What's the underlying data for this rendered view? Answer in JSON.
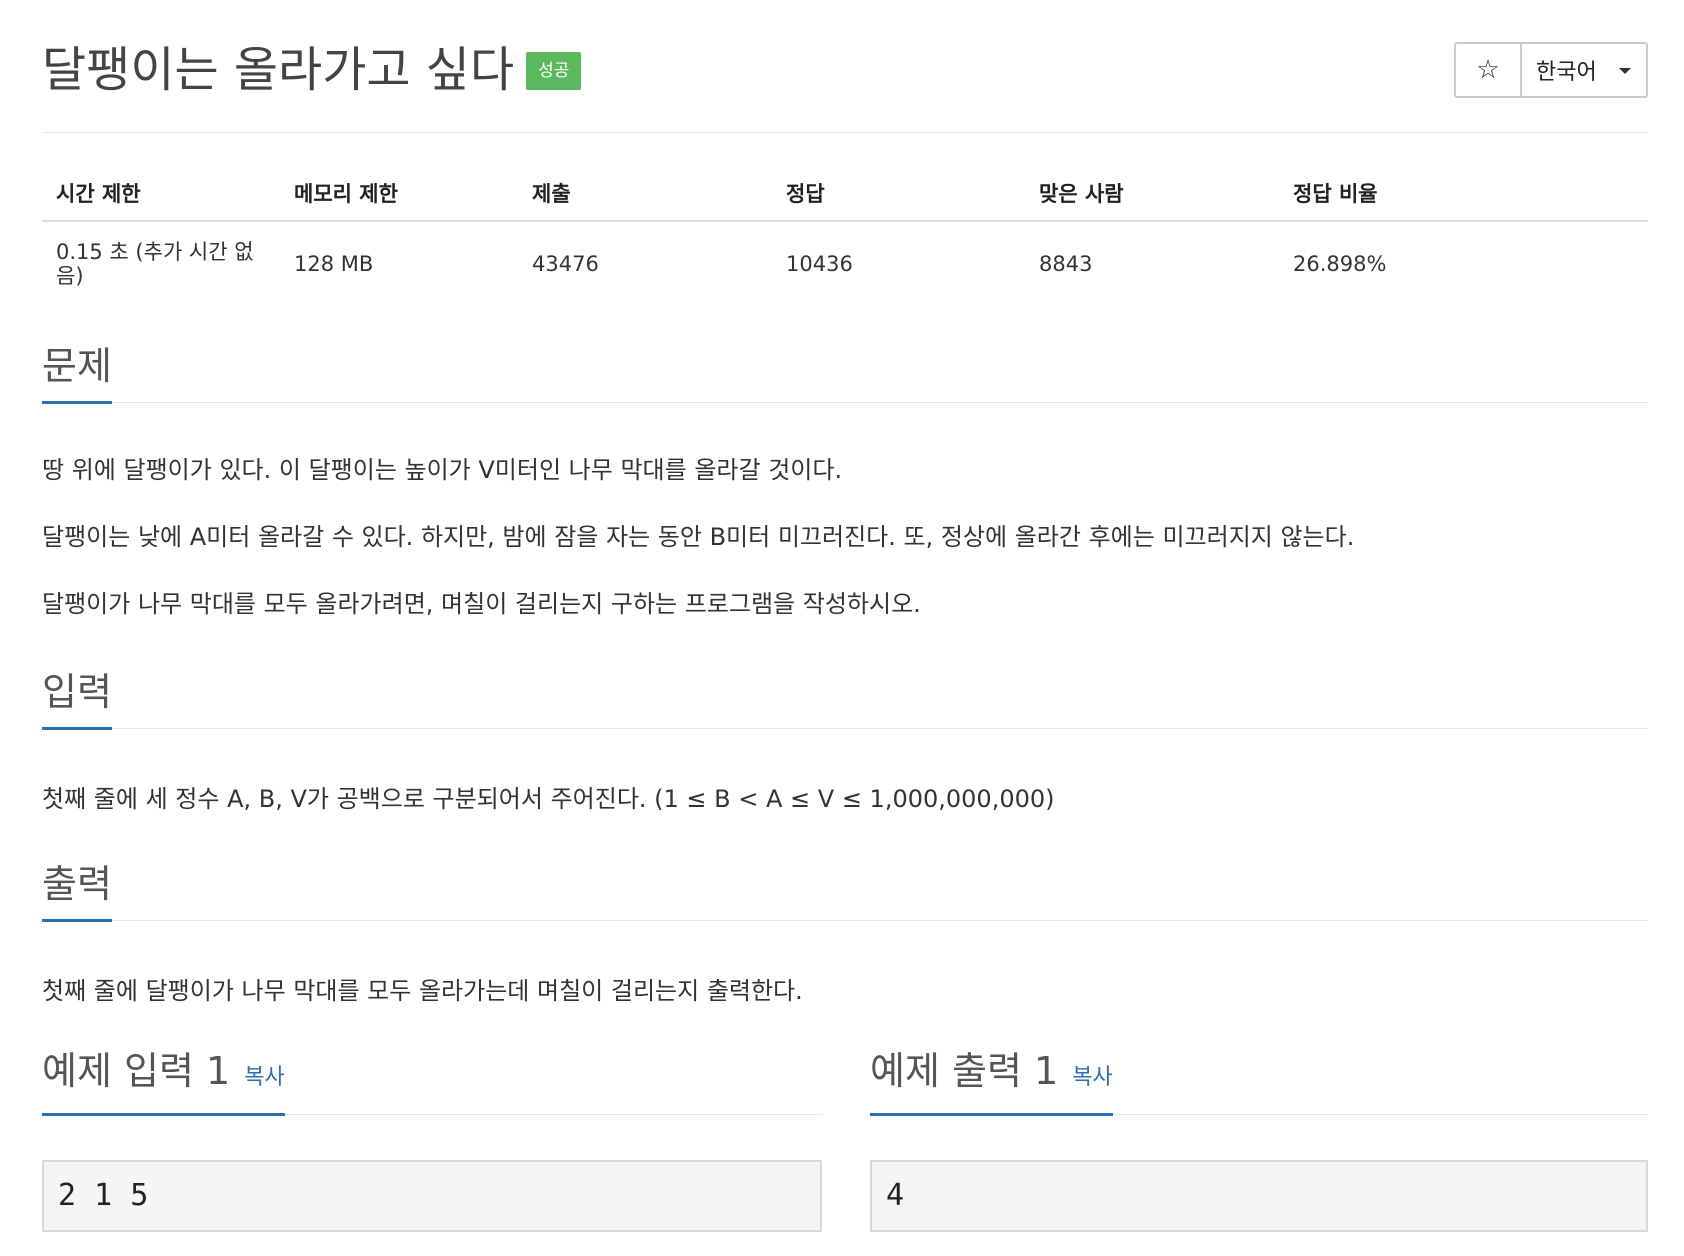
{
  "problem": {
    "title": "달팽이는 올라가고 싶다",
    "badge": "성공",
    "star_icon": "☆",
    "language": "한국어"
  },
  "info": {
    "headers": [
      "시간 제한",
      "메모리 제한",
      "제출",
      "정답",
      "맞은 사람",
      "정답 비율"
    ],
    "values": [
      "0.15 초 (추가 시간 없음)",
      "128 MB",
      "43476",
      "10436",
      "8843",
      "26.898%"
    ]
  },
  "sections": {
    "description": {
      "title": "문제",
      "paragraphs": [
        "땅 위에 달팽이가 있다. 이 달팽이는 높이가 V미터인 나무 막대를 올라갈 것이다.",
        "달팽이는 낮에 A미터 올라갈 수 있다. 하지만, 밤에 잠을 자는 동안 B미터 미끄러진다. 또, 정상에 올라간 후에는 미끄러지지 않는다.",
        "달팽이가 나무 막대를 모두 올라가려면, 며칠이 걸리는지 구하는 프로그램을 작성하시오."
      ]
    },
    "input": {
      "title": "입력",
      "text": "첫째 줄에 세 정수 A, B, V가 공백으로 구분되어서 주어진다. (1 ≤ B < A ≤ V ≤ 1,000,000,000)"
    },
    "output": {
      "title": "출력",
      "text": "첫째 줄에 달팽이가 나무 막대를 모두 올라가는데 며칠이 걸리는지 출력한다."
    }
  },
  "samples": {
    "input_title": "예제 입력 1",
    "output_title": "예제 출력 1",
    "copy_label": "복사",
    "input_value": "2 1 5",
    "output_value": "4"
  }
}
